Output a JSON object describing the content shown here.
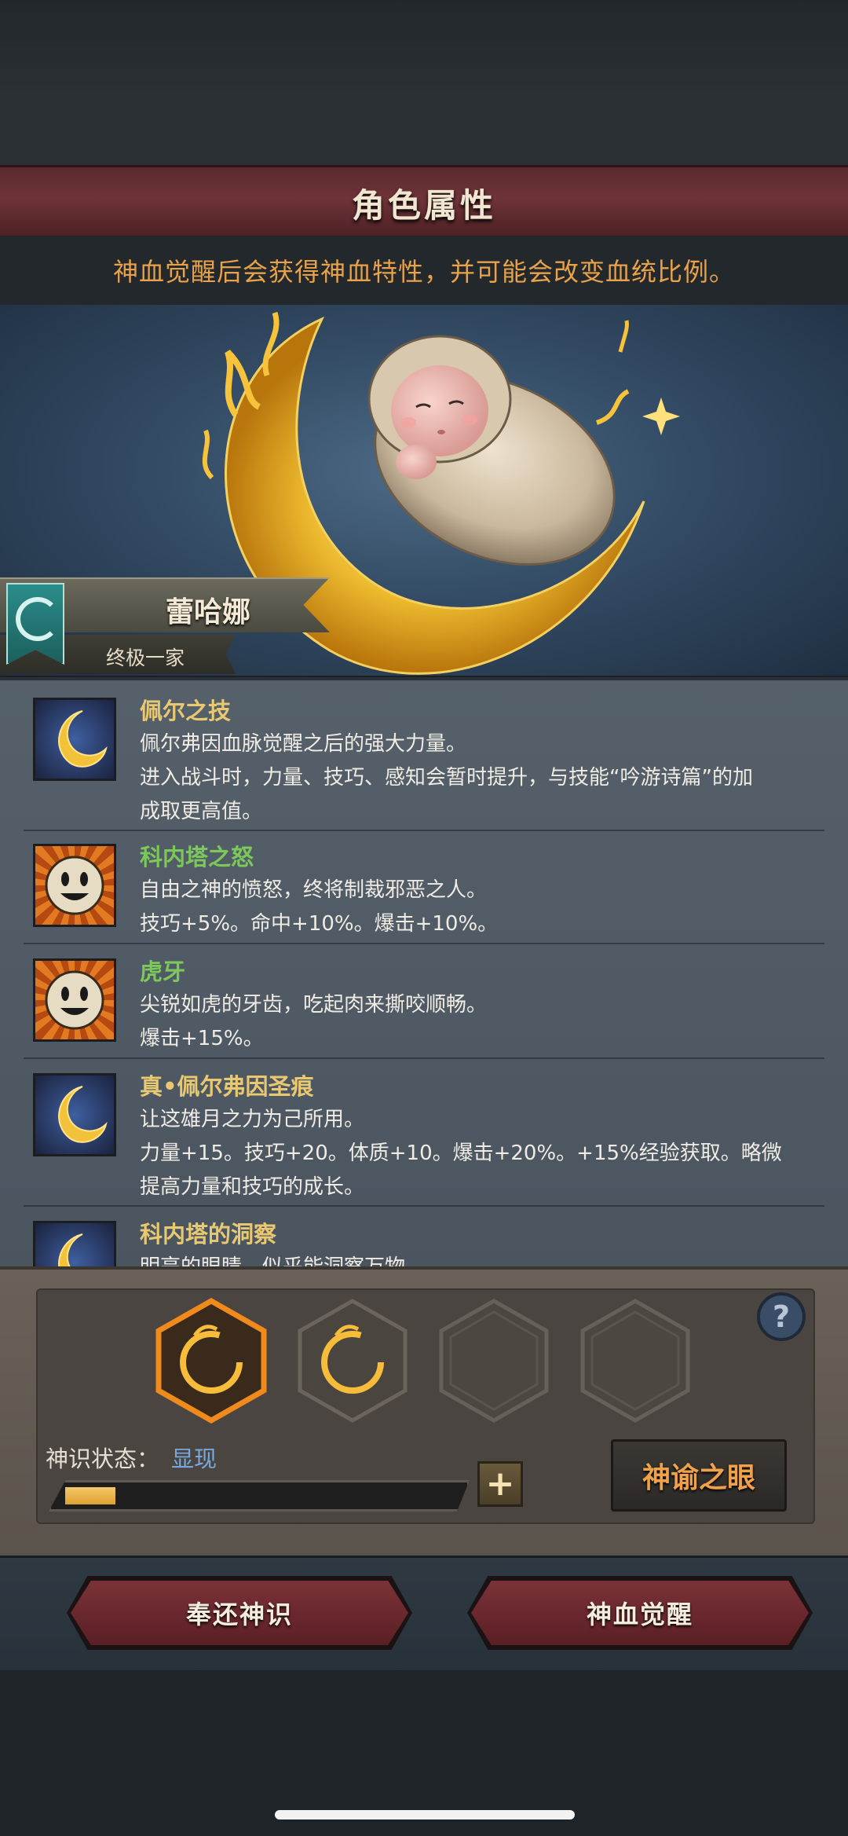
{
  "header": {
    "title": "角色属性",
    "subtitle": "神血觉醒后会获得神血特性，并可能会改变血统比例。"
  },
  "character": {
    "name": "蕾哈娜",
    "family": "终极一家",
    "crest_icon": "swirl-crest-icon",
    "portrait": "swaddled-baby-on-crescent-moon"
  },
  "traits": [
    {
      "icon": "crescent-moon-icon",
      "name": "佩尔之技",
      "name_color": "#e8c871",
      "lines": [
        "佩尔弗因血脉觉醒之后的强大力量。",
        "进入战斗时，力量、技巧、感知会暂时提升，与技能“吟游诗篇”的加",
        "成取更高值。"
      ]
    },
    {
      "icon": "smiling-sun-icon",
      "name": "科内塔之怒",
      "name_color": "#7cc85a",
      "lines": [
        "自由之神的愤怒，终将制裁邪恶之人。",
        "技巧+5%。命中+10%。爆击+10%。"
      ]
    },
    {
      "icon": "smiling-sun-icon",
      "name": "虎牙",
      "name_color": "#7cc85a",
      "lines": [
        "尖锐如虎的牙齿，吃起肉来撕咬顺畅。",
        "爆击+15%。"
      ]
    },
    {
      "icon": "crescent-moon-icon",
      "name": "真•佩尔弗因圣痕",
      "name_color": "#e8c871",
      "lines": [
        "让这雄月之力为己所用。",
        "力量+15。技巧+20。体质+10。爆击+20%。+15%经验获取。略微",
        "提高力量和技巧的成长。"
      ]
    },
    {
      "icon": "crescent-moon-icon",
      "name": "科内塔的洞察",
      "name_color": "#e8c871",
      "lines": [
        "明亮的眼睛，似乎能洞察万物。"
      ]
    }
  ],
  "divine_slots": [
    {
      "state": "selected",
      "icon": "golden-crescent-icon"
    },
    {
      "state": "filled",
      "icon": "golden-crescent-icon"
    },
    {
      "state": "empty",
      "icon": ""
    },
    {
      "state": "empty",
      "icon": ""
    }
  ],
  "status": {
    "label": "神识状态：",
    "value": "显现",
    "progress": 0.13,
    "plus_label": "+",
    "help_label": "?"
  },
  "buttons": {
    "oracle": "神谕之眼",
    "return": "奉还神识",
    "awaken": "神血觉醒"
  },
  "colors": {
    "title_bar": "#6e3338",
    "subtitle_text": "#e8a24a",
    "status_value": "#78a8e0",
    "oracle_text": "#f0a24a",
    "progress_fill": "#e0a030"
  }
}
